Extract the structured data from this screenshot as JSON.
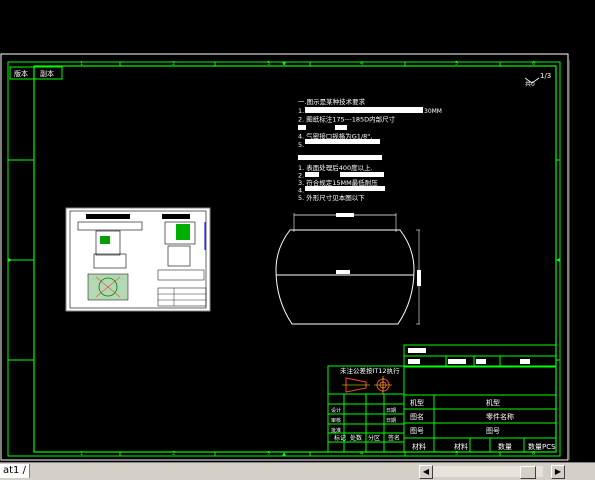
{
  "drawing": {
    "corner_tabs": [
      "版本",
      "副本"
    ],
    "sheet_info": {
      "count": "1/3",
      "total_label": "共0"
    },
    "tech_req_a_title": "一.图示是某种技术要求",
    "tech_req_a_lines": [
      "1.",
      "2. 图纸标注175---185D内部尺寸",
      "3.",
      "4. 气密接口规格为G1/8\",",
      "5."
    ],
    "tech_req_a_tail": "30MM",
    "tech_req_b_lines": [
      "1. 表面处理后400度以上.",
      "2.",
      "3. 符合规定15MM最低耐压",
      "4.",
      "5. 外形尺寸见本图以下"
    ],
    "ball_labels": {
      "top_dim": "Φ",
      "mid_dim": "Φ",
      "right_dim": "Φ"
    },
    "title_block": {
      "tolerance_note": "未注公差按IT12执行",
      "top_cells": [
        "",
        "",
        "",
        ""
      ],
      "rows": [
        {
          "label": "机型",
          "value": "机型"
        },
        {
          "label": "图名",
          "value": "零件名称"
        },
        {
          "label": "图号",
          "value": "图号"
        }
      ],
      "left_grid_labels": [
        "",
        "设计",
        "审核",
        "批准"
      ],
      "left_grid_labels2": [
        "",
        "日期",
        "日期",
        ""
      ],
      "bottom_row": [
        "标记",
        "处数",
        "分区",
        "签名"
      ],
      "material_label": "材料",
      "material_value": "材料",
      "qty_label": "数量",
      "qty_value": "数量PCS"
    },
    "colors": {
      "frame": "#00ff00",
      "text": "#ffffff",
      "accent": "#ff0000",
      "blue": "#0000ff"
    }
  },
  "statusbar": {
    "layout_tab": "at1 /",
    "scroll_left_icon": "triangle-left-icon",
    "scroll_right_icon": "triangle-right-icon"
  }
}
